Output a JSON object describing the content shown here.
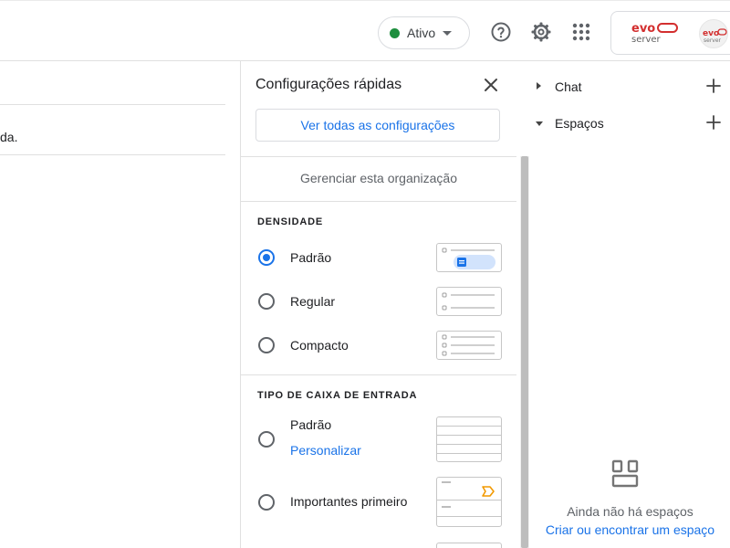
{
  "header": {
    "status": {
      "label": "Ativo",
      "dot_color": "#1e8e3e"
    },
    "icons": [
      "help-icon",
      "settings-icon",
      "apps-icon"
    ],
    "brand": {
      "logo_word_top": "evo",
      "logo_word_bottom": "server"
    }
  },
  "mail": {
    "snippet": "da."
  },
  "quick_settings": {
    "title": "Configurações rápidas",
    "see_all_button": "Ver todas as configurações",
    "manage_org": "Gerenciar esta organização",
    "density": {
      "heading": "DENSIDADE",
      "options": [
        {
          "label": "Padrão",
          "checked": true
        },
        {
          "label": "Regular",
          "checked": false
        },
        {
          "label": "Compacto",
          "checked": false
        }
      ]
    },
    "inbox_type": {
      "heading": "TIPO DE CAIXA DE ENTRADA",
      "options": [
        {
          "label": "Padrão",
          "link": "Personalizar",
          "checked": false
        },
        {
          "label": "Importantes primeiro",
          "checked": false
        }
      ]
    },
    "accent_color": "#1a73e8",
    "important_marker_color": "#f29900"
  },
  "chat_panel": {
    "chat_label": "Chat",
    "spaces_label": "Espaços",
    "empty_message": "Ainda não há espaços",
    "empty_link": "Criar ou encontrar um espaço"
  }
}
